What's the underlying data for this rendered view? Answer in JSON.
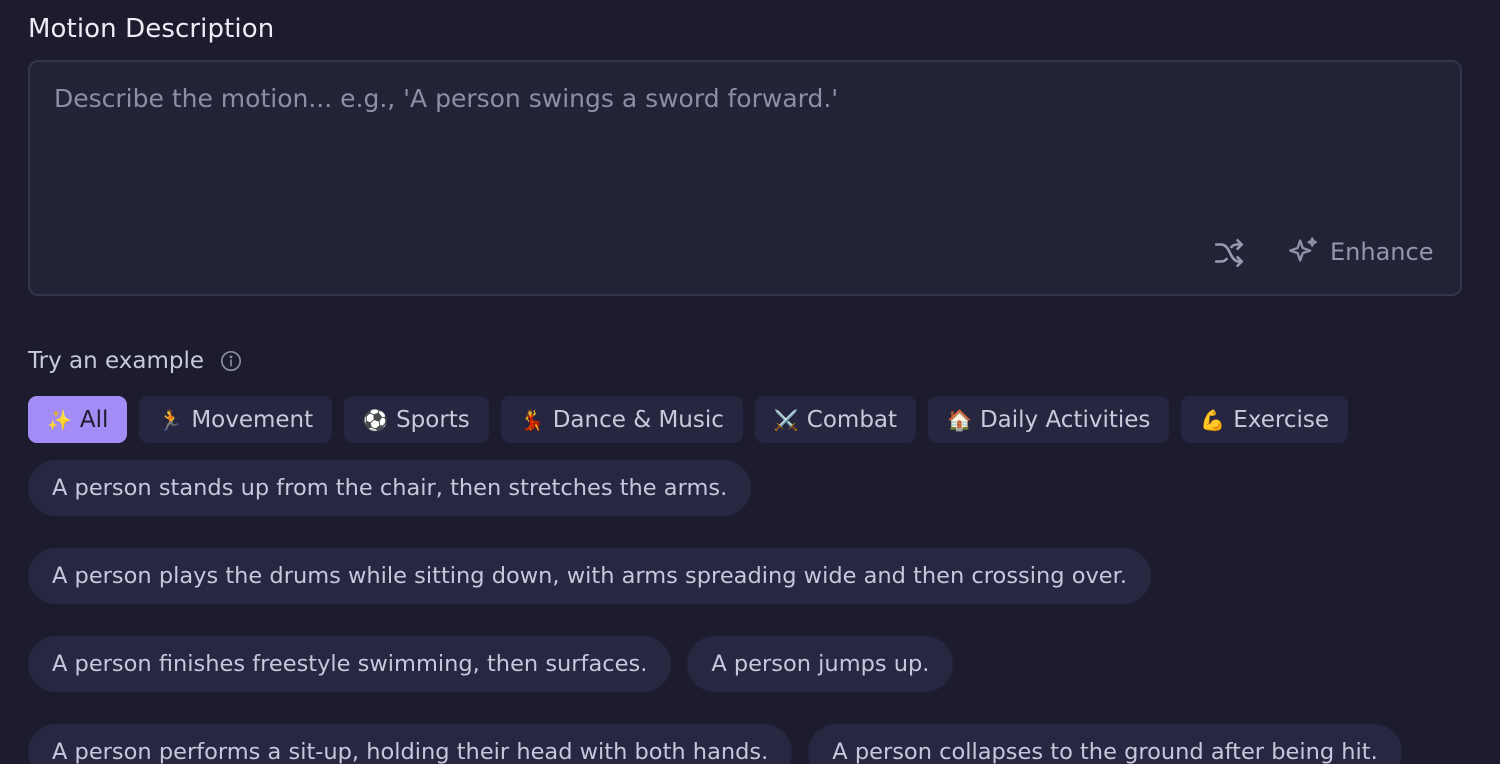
{
  "section": {
    "title": "Motion Description"
  },
  "prompt": {
    "value": "",
    "placeholder": "Describe the motion... e.g., 'A person swings a sword forward.'"
  },
  "actions": {
    "shuffle_icon": "shuffle-icon",
    "enhance_icon": "sparkles-icon",
    "enhance_label": "Enhance"
  },
  "examples_header": {
    "label": "Try an example",
    "info_icon": "info-icon"
  },
  "categories": [
    {
      "emoji": "✨",
      "label": "All",
      "active": true
    },
    {
      "emoji": "🏃",
      "label": "Movement",
      "active": false
    },
    {
      "emoji": "⚽",
      "label": "Sports",
      "active": false
    },
    {
      "emoji": "💃",
      "label": "Dance & Music",
      "active": false
    },
    {
      "emoji": "⚔️",
      "label": "Combat",
      "active": false
    },
    {
      "emoji": "🏠",
      "label": "Daily Activities",
      "active": false
    },
    {
      "emoji": "💪",
      "label": "Exercise",
      "active": false
    }
  ],
  "examples": [
    "A person stands up from the chair, then stretches the arms.",
    "A person plays the drums while sitting down, with arms spreading wide and then crossing over.",
    "A person finishes freestyle swimming, then surfaces.",
    "A person jumps up.",
    "A person performs a sit-up, holding their head with both hands.",
    "A person collapses to the ground after being hit."
  ],
  "colors": {
    "background": "#1c1c2e",
    "accent": "#a48cf7",
    "chip_bg": "#262640",
    "pill_bg": "#272742"
  }
}
